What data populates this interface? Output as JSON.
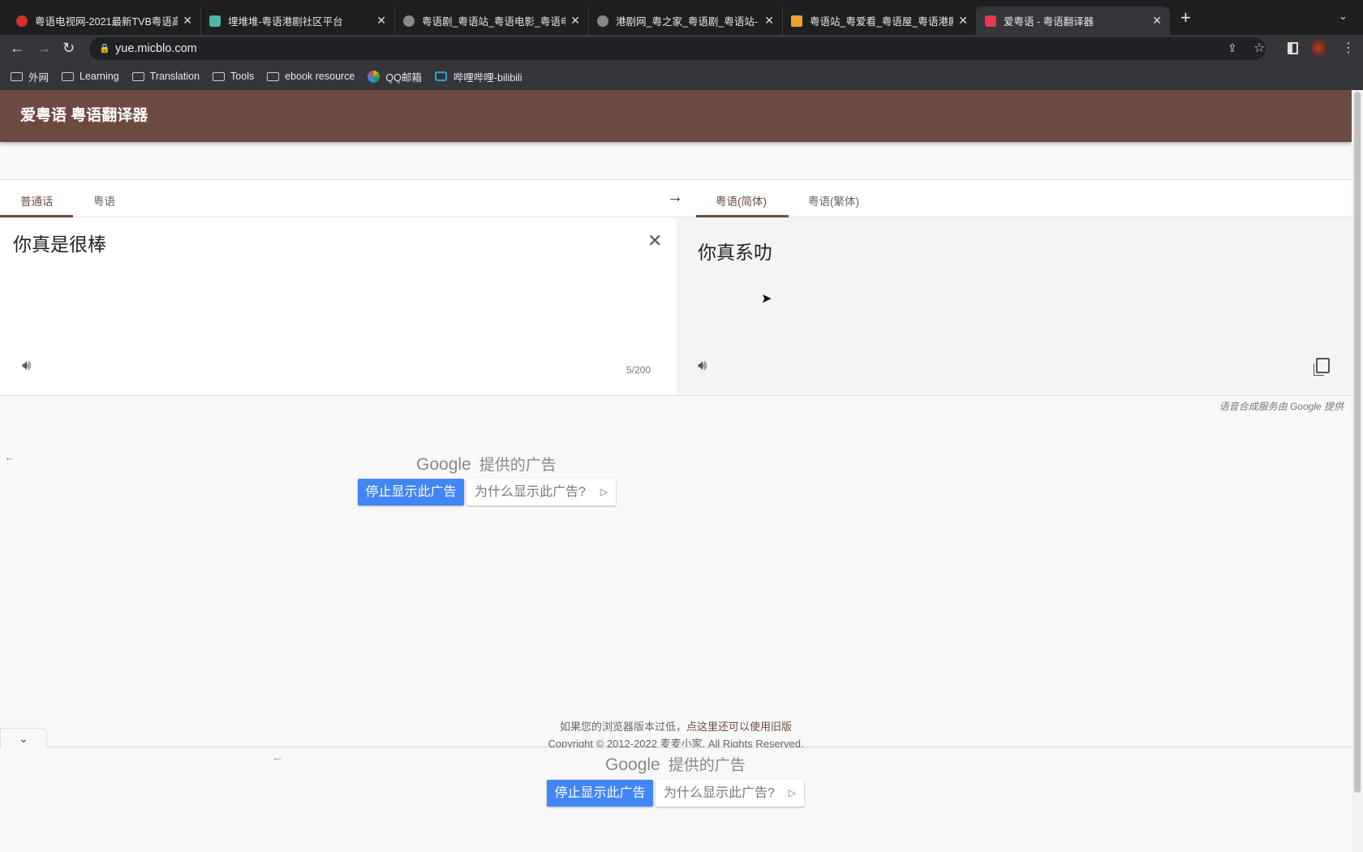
{
  "browser": {
    "tabs": [
      {
        "title": "粤语电视网-2021最新TVB粤语高",
        "favicon_color": "#d32f2f"
      },
      {
        "title": "埋堆堆-粤语港剧社区平台",
        "favicon_color": "#4db6ac"
      },
      {
        "title": "粤语剧_粤语站_粤语电影_粤语电",
        "favicon_color": "#888888"
      },
      {
        "title": "港剧网_粤之家_粤语剧_粤语站-",
        "favicon_color": "#888888"
      },
      {
        "title": "粤语站_粤爱看_粤语屋_粤语港剧",
        "favicon_color": "#f0a030"
      },
      {
        "title": "爱粤语 - 粤语翻译器",
        "favicon_color": "#e53950",
        "active": true
      }
    ],
    "url": "yue.micblo.com",
    "bookmarks": [
      {
        "label": "外网",
        "icon": "folder-icon"
      },
      {
        "label": "Learning",
        "icon": "folder-icon"
      },
      {
        "label": "Translation",
        "icon": "folder-icon"
      },
      {
        "label": "Tools",
        "icon": "folder-icon"
      },
      {
        "label": "ebook resource",
        "icon": "folder-icon"
      },
      {
        "label": "QQ邮箱",
        "icon": "qq-mail-icon"
      },
      {
        "label": "哔哩哔哩-bilibili",
        "icon": "bilibili-icon"
      }
    ]
  },
  "app": {
    "title": "爱粤语 粤语翻译器",
    "brand_color": "#6d4a41",
    "source_tabs": [
      "普通话",
      "粤语"
    ],
    "target_tabs": [
      "粤语(简体)",
      "粤语(繁体)"
    ],
    "swap_arrow": "→",
    "input_text": "你真是很棒",
    "char_count": "5/200",
    "output_text": "你真系叻",
    "tts_credit": "语音合成服务由 Google 提供"
  },
  "ads": {
    "google": "Google",
    "label": "提供的广告",
    "stop_button": "停止显示此广告",
    "why_button": "为什么显示此广告?",
    "back_arrow": "←"
  },
  "footer": {
    "line1_prefix": "如果您的浏览器版本过低，",
    "line1_link": "点这里还可以使用旧版",
    "copyright": "Copyright © 2012-2022 麦麦小家. All Rights Reserved."
  }
}
